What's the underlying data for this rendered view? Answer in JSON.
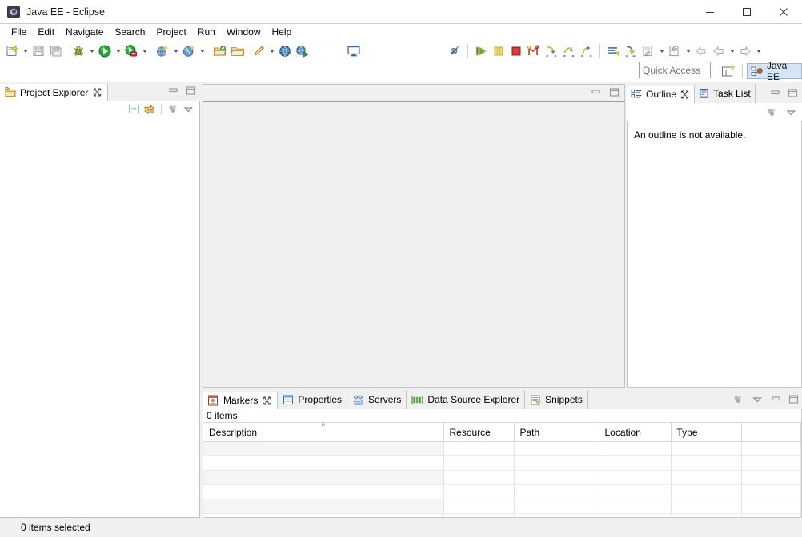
{
  "window": {
    "title": "Java EE - Eclipse",
    "icon": "eclipse-icon",
    "controls": {
      "minimize": "minimize-icon",
      "maximize": "maximize-icon",
      "close": "close-icon"
    }
  },
  "menu": {
    "items": [
      {
        "label": "File"
      },
      {
        "label": "Edit"
      },
      {
        "label": "Navigate"
      },
      {
        "label": "Search"
      },
      {
        "label": "Project"
      },
      {
        "label": "Run"
      },
      {
        "label": "Window"
      },
      {
        "label": "Help"
      }
    ]
  },
  "toolbar": {
    "groups": [
      {
        "name": "new-wizard",
        "icon": "new-file-icon",
        "arrow": true
      },
      {
        "name": "save",
        "icon": "save-icon",
        "arrow": false
      },
      {
        "name": "save-all",
        "icon": "save-all-icon",
        "arrow": false
      },
      {
        "name": "debug",
        "icon": "debug-bug-icon",
        "arrow": true
      },
      {
        "name": "run",
        "icon": "run-green-play-icon",
        "arrow": true
      },
      {
        "name": "run-last-tool",
        "icon": "external-tools-icon",
        "arrow": true
      },
      {
        "name": "run-server",
        "icon": "run-on-server-icon",
        "arrow": true
      },
      {
        "name": "search-s",
        "icon": "search-s-icon",
        "arrow": true
      },
      {
        "name": "open-type",
        "icon": "open-type-icon",
        "arrow": false
      },
      {
        "name": "open-task",
        "icon": "open-folder-icon",
        "arrow": false
      },
      {
        "name": "new-annotation",
        "icon": "pencil-icon",
        "arrow": true
      },
      {
        "name": "open-web-browser",
        "icon": "globe-icon",
        "arrow": false
      },
      {
        "name": "run-js",
        "icon": "run-javascript-icon",
        "arrow": false
      }
    ],
    "middle": [
      {
        "name": "console",
        "icon": "console-monitor-icon"
      }
    ],
    "debug_controls": [
      {
        "name": "skip-breakpoints",
        "icon": "skip-breakpoints-icon"
      },
      {
        "name": "resume",
        "icon": "resume-icon"
      },
      {
        "name": "suspend",
        "icon": "suspend-icon"
      },
      {
        "name": "terminate",
        "icon": "terminate-icon"
      },
      {
        "name": "disconnect",
        "icon": "disconnect-icon"
      },
      {
        "name": "step-into",
        "icon": "step-into-icon"
      },
      {
        "name": "step-over",
        "icon": "step-over-icon"
      },
      {
        "name": "step-return",
        "icon": "step-return-icon"
      }
    ],
    "right_controls": [
      {
        "name": "next-annotation",
        "icon": "next-annotation-icon",
        "arrow": false
      },
      {
        "name": "previous-annotation",
        "icon": "previous-annotation-icon",
        "arrow": false
      },
      {
        "name": "last-edit-location",
        "icon": "last-edit-location-icon",
        "arrow": true
      },
      {
        "name": "next-edit-location",
        "icon": "next-edit-location-icon",
        "arrow": true
      },
      {
        "name": "back-grey",
        "icon": "back-arrow-grey-icon",
        "arrow": false
      },
      {
        "name": "back",
        "icon": "back-arrow-icon",
        "arrow": true
      },
      {
        "name": "forward",
        "icon": "forward-arrow-icon",
        "arrow": true
      }
    ]
  },
  "quick_access": {
    "placeholder": "Quick Access",
    "value": ""
  },
  "perspective": {
    "open_perspective_icon": "open-perspective-icon",
    "active": {
      "label": "Java EE",
      "icon": "java-ee-perspective-icon"
    }
  },
  "project_explorer": {
    "tab": {
      "label": "Project Explorer",
      "icon": "project-explorer-icon",
      "close_icon": "close-tab-icon"
    },
    "view_buttons": [
      {
        "name": "collapse-all",
        "icon": "collapse-all-icon"
      },
      {
        "name": "link-with-editor",
        "icon": "link-with-editor-icon"
      },
      {
        "name": "view-menu-focus",
        "icon": "focus-icon"
      },
      {
        "name": "view-menu",
        "icon": "view-menu-chevron-icon"
      }
    ],
    "minimize_icon": "minimize-view-icon",
    "maximize_icon": "maximize-view-icon",
    "content": ""
  },
  "editor_area": {
    "minimize_icon": "minimize-view-icon",
    "maximize_icon": "maximize-view-icon",
    "content": ""
  },
  "outline": {
    "tabs": [
      {
        "label": "Outline",
        "icon": "outline-icon",
        "active": true,
        "close_icon": "close-tab-icon"
      },
      {
        "label": "Task List",
        "icon": "task-list-icon",
        "active": false
      }
    ],
    "view_buttons": [
      {
        "name": "focus-icon",
        "icon": "focus-icon"
      },
      {
        "name": "view-menu-chevron-icon",
        "icon": "view-menu-chevron-icon"
      }
    ],
    "minimize_icon": "minimize-view-icon",
    "maximize_icon": "maximize-view-icon",
    "message": "An outline is not available."
  },
  "markers": {
    "tabs": [
      {
        "label": "Markers",
        "icon": "markers-icon",
        "active": true,
        "close_icon": "close-tab-icon"
      },
      {
        "label": "Properties",
        "icon": "properties-icon",
        "active": false
      },
      {
        "label": "Servers",
        "icon": "servers-icon",
        "active": false
      },
      {
        "label": "Data Source Explorer",
        "icon": "data-source-explorer-icon",
        "active": false
      },
      {
        "label": "Snippets",
        "icon": "snippets-icon",
        "active": false
      }
    ],
    "view_buttons": [
      {
        "name": "focus-icon",
        "icon": "focus-icon"
      },
      {
        "name": "view-menu-chevron-icon",
        "icon": "view-menu-chevron-icon"
      }
    ],
    "minimize_icon": "minimize-view-icon",
    "maximize_icon": "maximize-view-icon",
    "items_count_label": "0 items",
    "table": {
      "columns": [
        {
          "label": "Description",
          "sorted": true,
          "sort_caret": "˄"
        },
        {
          "label": "Resource",
          "sorted": false
        },
        {
          "label": "Path",
          "sorted": false
        },
        {
          "label": "Location",
          "sorted": false
        },
        {
          "label": "Type",
          "sorted": false
        },
        {
          "label": "",
          "sorted": false
        }
      ],
      "rows": []
    }
  },
  "status_bar": {
    "text": "0 items selected"
  },
  "colors": {
    "window_bg": "#f0f0f0",
    "panel_bg": "#ffffff",
    "titlebar_border": "#d6c9d2",
    "tab_active_bg": "#ffffff",
    "perspective_active_bg": "#d6e5f5",
    "border": "#c7c7c7",
    "row_stripe": "#f5f5f5"
  }
}
